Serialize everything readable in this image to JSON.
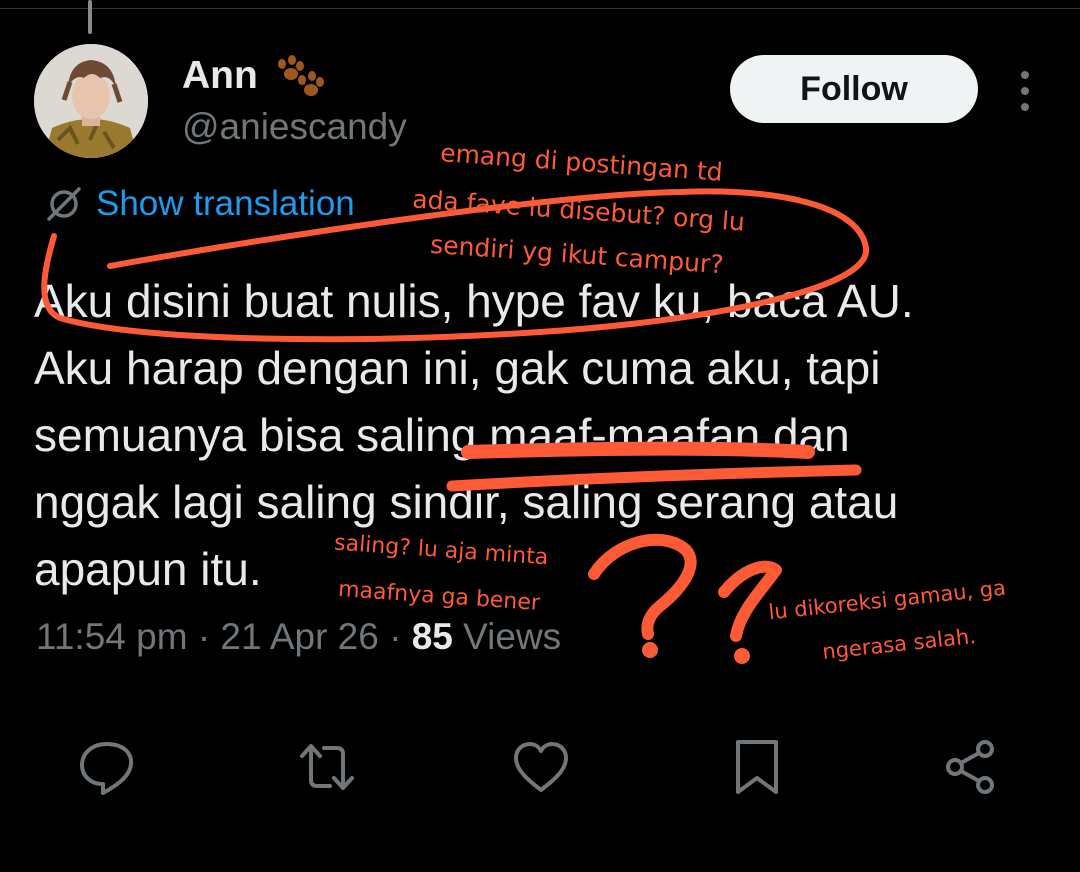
{
  "tweet": {
    "display_name": "Ann",
    "handle": "@aniescandy",
    "name_emoji_icon": "paw-prints-icon",
    "follow_label": "Follow",
    "translate_label": "Show translation",
    "text": "Aku disini buat nulis, hype fav ku, baca AU.\nAku harap dengan ini, gak cuma aku, tapi\nsemuanya bisa saling maaf-maafan dan\nnggak lagi saling sindir, saling serang atau\napapun itu.",
    "time": "11:54 pm",
    "date": "21 Apr 26",
    "views_count": "85",
    "views_label": "Views",
    "separator": "·"
  },
  "actions": [
    {
      "name": "reply",
      "icon": "reply-icon"
    },
    {
      "name": "retweet",
      "icon": "retweet-icon"
    },
    {
      "name": "like",
      "icon": "heart-icon"
    },
    {
      "name": "bookmark",
      "icon": "bookmark-icon"
    },
    {
      "name": "share",
      "icon": "share-icon"
    }
  ],
  "annotations": {
    "note1_line1": "emang di postingan td",
    "note1_line2": "ada fave lu disebut? org lu",
    "note1_line3": "sendiri yg ikut campur?",
    "note2_line1": "saling? lu aja minta",
    "note2_line2": "maafnya ga bener",
    "note3_line1": "lu dikoreksi gamau, ga",
    "note3_line2": "ngerasa salah."
  },
  "colors": {
    "background": "#000000",
    "text": "#e7e9ea",
    "muted": "#71767b",
    "link": "#1d9bf0",
    "follow_bg": "#eff3f4",
    "annotation": "#ff5a36"
  }
}
